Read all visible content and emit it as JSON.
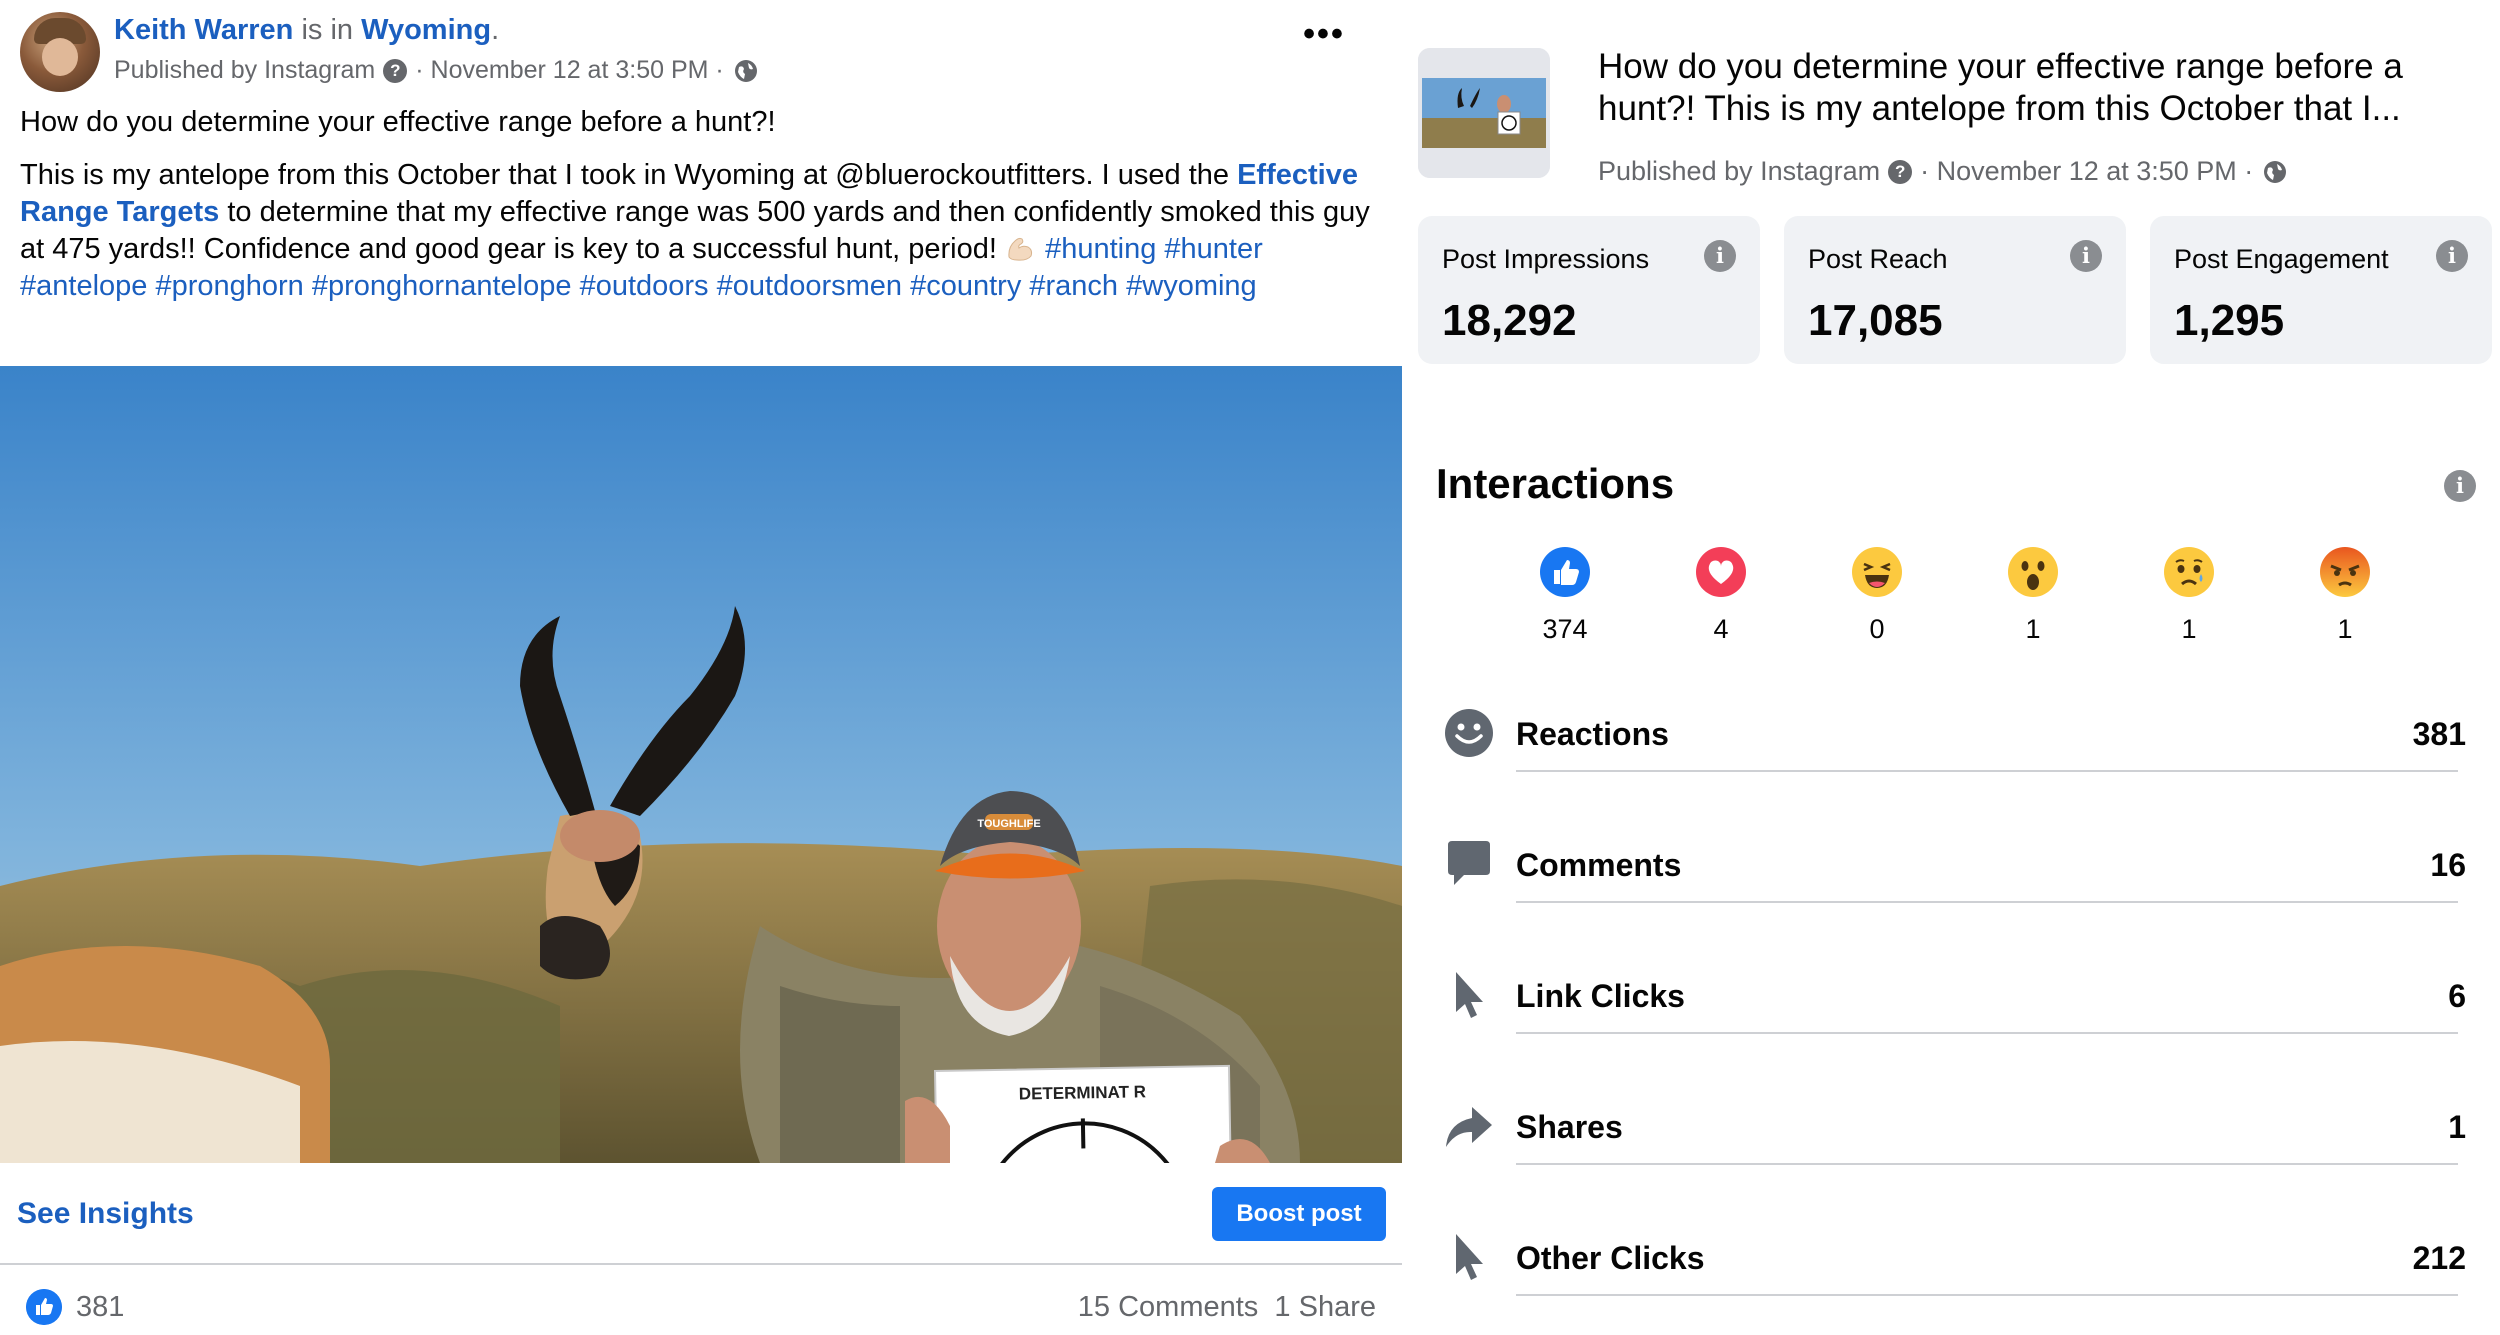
{
  "post": {
    "author": "Keith Warren",
    "location_connector": " is in ",
    "location": "Wyoming",
    "location_suffix": ".",
    "published_by": "Published by Instagram",
    "timestamp": "· November 12 at 3:50 PM ·",
    "question_line": "How do you determine your effective range before a hunt?!",
    "body_before_link": "This is my antelope from this October that I took in Wyoming at @bluerockoutfitters. I used the ",
    "body_link": "Effective Range Targets",
    "body_after_link": " to determine that my effective range was 500 yards and then confidently smoked this guy at 475 yards!! Confidence and good gear is key to a successful hunt, period! ",
    "hashtags": [
      "#hunting",
      "#hunter",
      "#antelope",
      "#pronghorn",
      "#pronghornantelope",
      "#outdoors",
      "#outdoorsmen",
      "#country",
      "#ranch",
      "#wyoming"
    ],
    "more_icon": "more-options-icon",
    "photo_target_brand": "DETERMINAT R",
    "photo_cap_brand": "TOUGHLIFE",
    "see_insights_label": "See Insights",
    "boost_label": "Boost post",
    "reaction_count": "381",
    "comments_shares": "15 Comments  1 Share"
  },
  "insights": {
    "title": "How do you determine your effective range before a hunt?! This is my antelope from this October that I...",
    "published_by": "Published by Instagram",
    "timestamp": "· November 12 at 3:50 PM ·",
    "stats": [
      {
        "label": "Post Impressions",
        "value": "18,292"
      },
      {
        "label": "Post Reach",
        "value": "17,085"
      },
      {
        "label": "Post Engagement",
        "value": "1,295"
      }
    ],
    "interactions_title": "Interactions",
    "reactions": [
      {
        "icon": "like-icon",
        "count": "374"
      },
      {
        "icon": "love-icon",
        "count": "4"
      },
      {
        "icon": "haha-icon",
        "count": "0"
      },
      {
        "icon": "wow-icon",
        "count": "1"
      },
      {
        "icon": "sad-icon",
        "count": "1"
      },
      {
        "icon": "angry-icon",
        "count": "1"
      }
    ],
    "metrics": [
      {
        "icon": "smiley-icon",
        "label": "Reactions",
        "value": "381"
      },
      {
        "icon": "comment-bubble-icon",
        "label": "Comments",
        "value": "16"
      },
      {
        "icon": "cursor-icon",
        "label": "Link Clicks",
        "value": "6"
      },
      {
        "icon": "share-arrow-icon",
        "label": "Shares",
        "value": "1"
      },
      {
        "icon": "cursor-icon",
        "label": "Other Clicks",
        "value": "212"
      }
    ]
  },
  "colors": {
    "link": "#1b5fbf",
    "boost_button": "#1877f2",
    "muted_text": "#65676b",
    "card_bg": "#f0f2f5"
  }
}
